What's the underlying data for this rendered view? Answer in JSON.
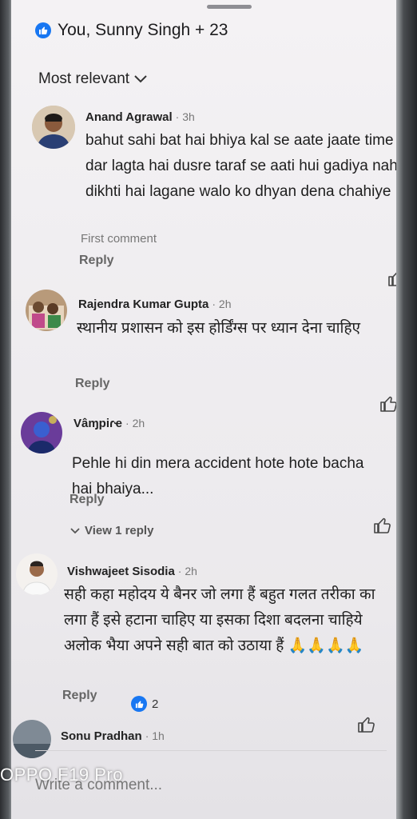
{
  "reactions": {
    "summary": "You, Sunny Singh + 23"
  },
  "sort": {
    "label": "Most relevant"
  },
  "comments": [
    {
      "author": "Anand Agrawal",
      "time": "· 3h",
      "text": "bahut sahi bat hai bhiya kal se aate jaate time dar lagta hai dusre taraf se aati hui gadiya nahi dikhti hai lagane walo ko dhyan dena chahiye",
      "meta": "First comment",
      "reply": "Reply"
    },
    {
      "author": "Rajendra Kumar Gupta",
      "time": "· 2h",
      "text": "स्थानीय प्रशासन को इस होर्डिंग्स पर ध्यान देना चाहिए",
      "reply": "Reply"
    },
    {
      "author": "Vâɱpiɾҽ",
      "time": "· 2h",
      "text": "Pehle hi din mera accident hote hote bacha hai bhaiya...",
      "reply": "Reply",
      "view_replies": "View 1 reply"
    },
    {
      "author": "Vishwajeet Sisodia",
      "time": "· 2h",
      "text": "सही कहा महोदय ये बैनर जो लगा हैं बहुत गलत तरीका का लगा हैं इसे हटाना चाहिए या इसका दिशा बदलना चाहिये अलोक भैया अपने सही बात को उठाया हैं 🙏🙏🙏🙏",
      "reply": "Reply",
      "reaction_count": "2"
    },
    {
      "author": "Sonu Pradhan",
      "time": "· 1h"
    }
  ],
  "composer": {
    "placeholder": "Write a comment..."
  },
  "watermark": "OPPO F19 Pro"
}
